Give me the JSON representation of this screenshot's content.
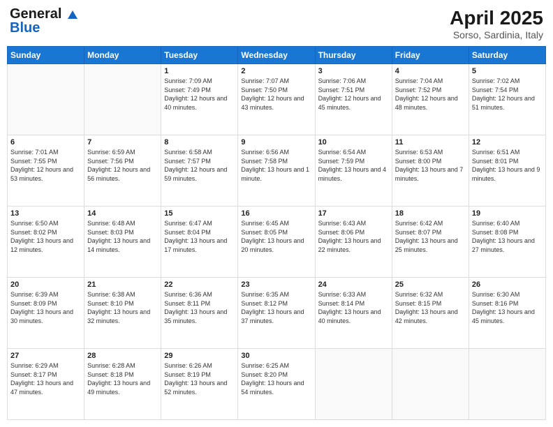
{
  "header": {
    "logo_line1": "General",
    "logo_line2": "Blue",
    "title": "April 2025",
    "subtitle": "Sorso, Sardinia, Italy"
  },
  "weekdays": [
    "Sunday",
    "Monday",
    "Tuesday",
    "Wednesday",
    "Thursday",
    "Friday",
    "Saturday"
  ],
  "weeks": [
    [
      {
        "day": "",
        "info": ""
      },
      {
        "day": "",
        "info": ""
      },
      {
        "day": "1",
        "info": "Sunrise: 7:09 AM\nSunset: 7:49 PM\nDaylight: 12 hours and 40 minutes."
      },
      {
        "day": "2",
        "info": "Sunrise: 7:07 AM\nSunset: 7:50 PM\nDaylight: 12 hours and 43 minutes."
      },
      {
        "day": "3",
        "info": "Sunrise: 7:06 AM\nSunset: 7:51 PM\nDaylight: 12 hours and 45 minutes."
      },
      {
        "day": "4",
        "info": "Sunrise: 7:04 AM\nSunset: 7:52 PM\nDaylight: 12 hours and 48 minutes."
      },
      {
        "day": "5",
        "info": "Sunrise: 7:02 AM\nSunset: 7:54 PM\nDaylight: 12 hours and 51 minutes."
      }
    ],
    [
      {
        "day": "6",
        "info": "Sunrise: 7:01 AM\nSunset: 7:55 PM\nDaylight: 12 hours and 53 minutes."
      },
      {
        "day": "7",
        "info": "Sunrise: 6:59 AM\nSunset: 7:56 PM\nDaylight: 12 hours and 56 minutes."
      },
      {
        "day": "8",
        "info": "Sunrise: 6:58 AM\nSunset: 7:57 PM\nDaylight: 12 hours and 59 minutes."
      },
      {
        "day": "9",
        "info": "Sunrise: 6:56 AM\nSunset: 7:58 PM\nDaylight: 13 hours and 1 minute."
      },
      {
        "day": "10",
        "info": "Sunrise: 6:54 AM\nSunset: 7:59 PM\nDaylight: 13 hours and 4 minutes."
      },
      {
        "day": "11",
        "info": "Sunrise: 6:53 AM\nSunset: 8:00 PM\nDaylight: 13 hours and 7 minutes."
      },
      {
        "day": "12",
        "info": "Sunrise: 6:51 AM\nSunset: 8:01 PM\nDaylight: 13 hours and 9 minutes."
      }
    ],
    [
      {
        "day": "13",
        "info": "Sunrise: 6:50 AM\nSunset: 8:02 PM\nDaylight: 13 hours and 12 minutes."
      },
      {
        "day": "14",
        "info": "Sunrise: 6:48 AM\nSunset: 8:03 PM\nDaylight: 13 hours and 14 minutes."
      },
      {
        "day": "15",
        "info": "Sunrise: 6:47 AM\nSunset: 8:04 PM\nDaylight: 13 hours and 17 minutes."
      },
      {
        "day": "16",
        "info": "Sunrise: 6:45 AM\nSunset: 8:05 PM\nDaylight: 13 hours and 20 minutes."
      },
      {
        "day": "17",
        "info": "Sunrise: 6:43 AM\nSunset: 8:06 PM\nDaylight: 13 hours and 22 minutes."
      },
      {
        "day": "18",
        "info": "Sunrise: 6:42 AM\nSunset: 8:07 PM\nDaylight: 13 hours and 25 minutes."
      },
      {
        "day": "19",
        "info": "Sunrise: 6:40 AM\nSunset: 8:08 PM\nDaylight: 13 hours and 27 minutes."
      }
    ],
    [
      {
        "day": "20",
        "info": "Sunrise: 6:39 AM\nSunset: 8:09 PM\nDaylight: 13 hours and 30 minutes."
      },
      {
        "day": "21",
        "info": "Sunrise: 6:38 AM\nSunset: 8:10 PM\nDaylight: 13 hours and 32 minutes."
      },
      {
        "day": "22",
        "info": "Sunrise: 6:36 AM\nSunset: 8:11 PM\nDaylight: 13 hours and 35 minutes."
      },
      {
        "day": "23",
        "info": "Sunrise: 6:35 AM\nSunset: 8:12 PM\nDaylight: 13 hours and 37 minutes."
      },
      {
        "day": "24",
        "info": "Sunrise: 6:33 AM\nSunset: 8:14 PM\nDaylight: 13 hours and 40 minutes."
      },
      {
        "day": "25",
        "info": "Sunrise: 6:32 AM\nSunset: 8:15 PM\nDaylight: 13 hours and 42 minutes."
      },
      {
        "day": "26",
        "info": "Sunrise: 6:30 AM\nSunset: 8:16 PM\nDaylight: 13 hours and 45 minutes."
      }
    ],
    [
      {
        "day": "27",
        "info": "Sunrise: 6:29 AM\nSunset: 8:17 PM\nDaylight: 13 hours and 47 minutes."
      },
      {
        "day": "28",
        "info": "Sunrise: 6:28 AM\nSunset: 8:18 PM\nDaylight: 13 hours and 49 minutes."
      },
      {
        "day": "29",
        "info": "Sunrise: 6:26 AM\nSunset: 8:19 PM\nDaylight: 13 hours and 52 minutes."
      },
      {
        "day": "30",
        "info": "Sunrise: 6:25 AM\nSunset: 8:20 PM\nDaylight: 13 hours and 54 minutes."
      },
      {
        "day": "",
        "info": ""
      },
      {
        "day": "",
        "info": ""
      },
      {
        "day": "",
        "info": ""
      }
    ]
  ]
}
